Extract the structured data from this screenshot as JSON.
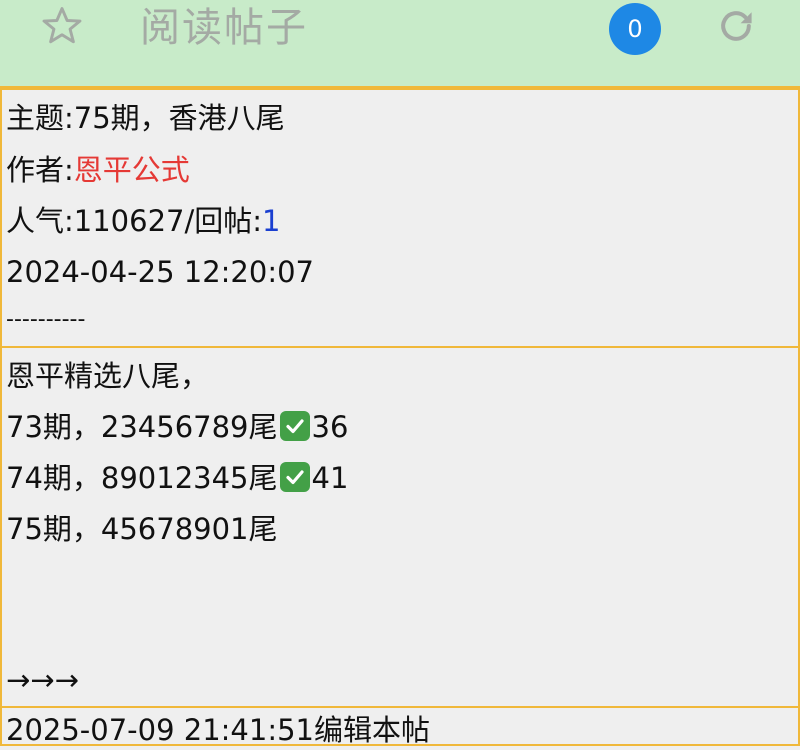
{
  "app": {
    "title": "阅读帖子",
    "unread_count": "0",
    "icons": {
      "favorite": "star-icon",
      "refresh": "refresh-icon"
    },
    "colors": {
      "header_bg": "#c8ebc9",
      "border": "#f0b83a",
      "badge": "#1e88e5",
      "author": "#e53935",
      "reply_count": "#1a3fd0",
      "check": "#43a047"
    }
  },
  "post": {
    "subject_label": "主题:",
    "subject": "75期，香港八尾",
    "author_label": "作者:",
    "author": "恩平公式",
    "popularity_label": "人气:",
    "popularity": "110627",
    "replies_label": "/回帖:",
    "replies": "1",
    "datetime": "2024-04-25 12:20:07",
    "separator": "----------"
  },
  "content": {
    "heading": "恩平精选八尾，",
    "rows": [
      {
        "text": "73期，23456789尾",
        "checked": true,
        "result": "36"
      },
      {
        "text": "74期，89012345尾",
        "checked": true,
        "result": "41"
      },
      {
        "text": "75期，45678901尾",
        "checked": false,
        "result": ""
      }
    ],
    "arrows": "→→→"
  },
  "footer": {
    "edit_note": "2025-07-09 21:41:51编辑本帖"
  }
}
